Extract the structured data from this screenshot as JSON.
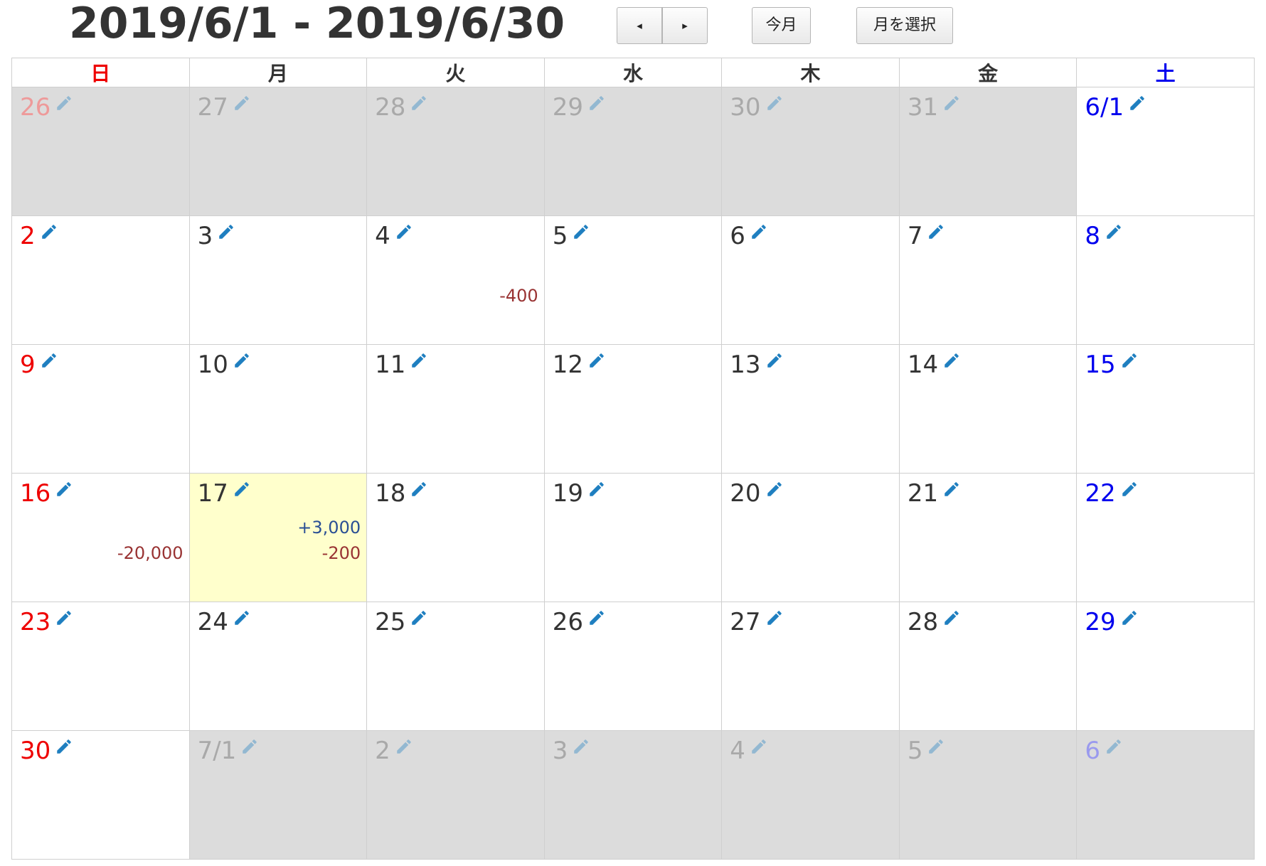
{
  "header": {
    "title": "2019/6/1 - 2019/6/30",
    "prev_label": "◂",
    "next_label": "▸",
    "today_label": "今月",
    "select_month_label": "月を選択"
  },
  "weekdays": [
    "日",
    "月",
    "火",
    "水",
    "木",
    "金",
    "土"
  ],
  "colors": {
    "sunday": "#ee0000",
    "saturday": "#0000ee",
    "other_month_bg": "#dcdcdc",
    "today_bg": "#ffffcc",
    "expense": "#993333",
    "income": "#2a4f94",
    "edit_icon": "#1f7fc0"
  },
  "weeks": [
    [
      {
        "label": "26",
        "other": true
      },
      {
        "label": "27",
        "other": true
      },
      {
        "label": "28",
        "other": true
      },
      {
        "label": "29",
        "other": true
      },
      {
        "label": "30",
        "other": true
      },
      {
        "label": "31",
        "other": true
      },
      {
        "label": "6/1",
        "other": false
      }
    ],
    [
      {
        "label": "2"
      },
      {
        "label": "3"
      },
      {
        "label": "4",
        "amounts": [
          {
            "text": "-400",
            "type": "neg"
          }
        ]
      },
      {
        "label": "5"
      },
      {
        "label": "6"
      },
      {
        "label": "7"
      },
      {
        "label": "8"
      }
    ],
    [
      {
        "label": "9"
      },
      {
        "label": "10"
      },
      {
        "label": "11"
      },
      {
        "label": "12"
      },
      {
        "label": "13"
      },
      {
        "label": "14"
      },
      {
        "label": "15"
      }
    ],
    [
      {
        "label": "16",
        "amounts": [
          {
            "text": "-20,000",
            "type": "neg"
          }
        ]
      },
      {
        "label": "17",
        "today": true,
        "amounts": [
          {
            "text": "+3,000",
            "type": "pos"
          },
          {
            "text": "-200",
            "type": "neg"
          }
        ]
      },
      {
        "label": "18"
      },
      {
        "label": "19"
      },
      {
        "label": "20"
      },
      {
        "label": "21"
      },
      {
        "label": "22"
      }
    ],
    [
      {
        "label": "23"
      },
      {
        "label": "24"
      },
      {
        "label": "25"
      },
      {
        "label": "26"
      },
      {
        "label": "27"
      },
      {
        "label": "28"
      },
      {
        "label": "29"
      }
    ],
    [
      {
        "label": "30"
      },
      {
        "label": "7/1",
        "other": true
      },
      {
        "label": "2",
        "other": true
      },
      {
        "label": "3",
        "other": true
      },
      {
        "label": "4",
        "other": true
      },
      {
        "label": "5",
        "other": true
      },
      {
        "label": "6",
        "other": true
      }
    ]
  ]
}
